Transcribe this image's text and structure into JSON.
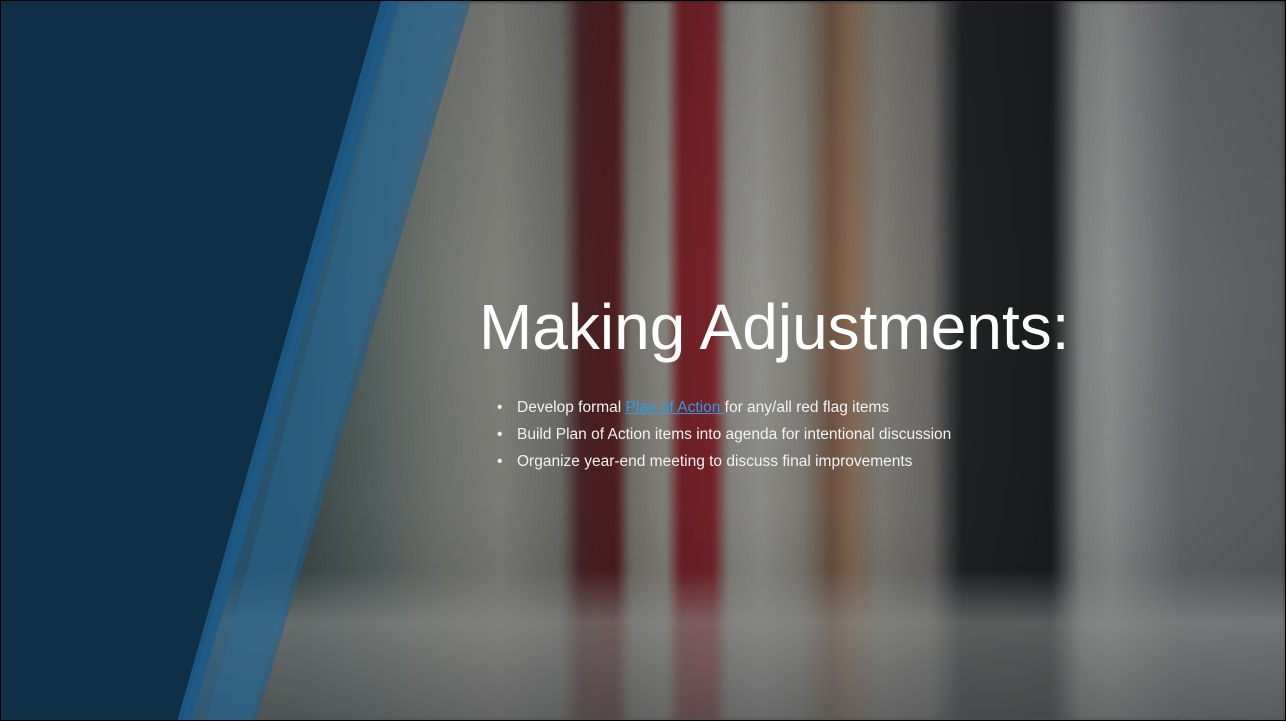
{
  "slide": {
    "title": "Making Adjustments:",
    "bullets": [
      {
        "before": "Develop formal ",
        "link": "Plan of Action ",
        "after": "for any/all red flag items"
      },
      {
        "text": "Build Plan of Action items into agenda for intentional discussion"
      },
      {
        "text": "Organize year-end meeting to discuss final improvements"
      }
    ]
  },
  "colors": {
    "panel_dark": "#0f2f46",
    "panel_accent": "#1e5a86",
    "link": "#2e9be6",
    "text": "#ffffff"
  },
  "background": {
    "image": "blurred row of books on a shelf"
  }
}
